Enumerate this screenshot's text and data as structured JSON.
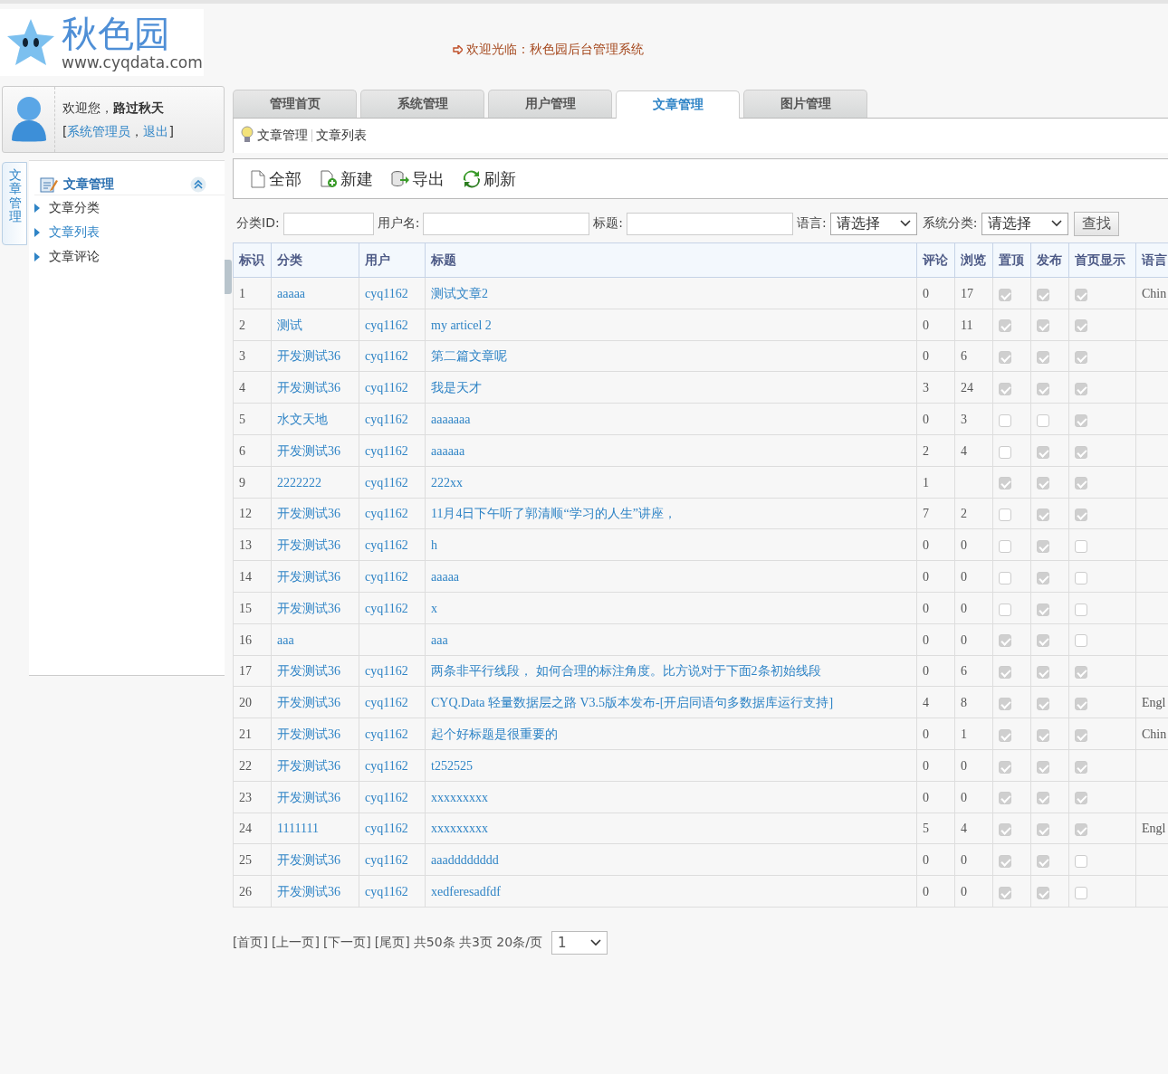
{
  "header": {
    "logo_title": "秋色园",
    "logo_url": "www.cyqdata.com",
    "welcome": "欢迎光临：秋色园后台管理系统"
  },
  "user_panel": {
    "greeting": "欢迎您，",
    "username": "路过秋天",
    "bracket_open": "[",
    "role_link": "系统管理员",
    "separator": "，",
    "logout_link": "退出",
    "bracket_close": "]"
  },
  "sidebar": {
    "vertical_tab": "文章管理",
    "section_title": "文章管理",
    "items": [
      {
        "label": "文章分类",
        "selected": false
      },
      {
        "label": "文章列表",
        "selected": true
      },
      {
        "label": "文章评论",
        "selected": false
      }
    ]
  },
  "tabs": [
    {
      "label": "管理首页",
      "selected": false
    },
    {
      "label": "系统管理",
      "selected": false
    },
    {
      "label": "用户管理",
      "selected": false
    },
    {
      "label": "文章管理",
      "selected": true
    },
    {
      "label": "图片管理",
      "selected": false
    }
  ],
  "breadcrumb": [
    "文章管理",
    "文章列表"
  ],
  "toolbar": [
    {
      "kind": "all",
      "label": "全部"
    },
    {
      "kind": "new",
      "label": "新建"
    },
    {
      "kind": "export",
      "label": "导出"
    },
    {
      "kind": "refresh",
      "label": "刷新"
    }
  ],
  "filters": [
    {
      "kind": "text",
      "label": "分类ID:"
    },
    {
      "kind": "text",
      "label": "用户名:"
    },
    {
      "kind": "text",
      "label": "标题:"
    },
    {
      "kind": "select",
      "label": "语言:",
      "value": "请选择"
    },
    {
      "kind": "select",
      "label": "系统分类:",
      "value": "请选择"
    }
  ],
  "search_button": "查找",
  "table": {
    "columns": [
      "标识",
      "分类",
      "用户",
      "标题",
      "评论",
      "浏览",
      "置顶",
      "发布",
      "首页显示",
      "语言"
    ],
    "rows": [
      {
        "id": "1",
        "category": "aaaaa",
        "user": "cyq1162",
        "title": "测试文章2",
        "comments": "0",
        "views": "17",
        "top": true,
        "published": true,
        "home": true,
        "language": "Chin"
      },
      {
        "id": "2",
        "category": "测试",
        "user": "cyq1162",
        "title": "my articel 2",
        "comments": "0",
        "views": "11",
        "top": true,
        "published": true,
        "home": true
      },
      {
        "id": "3",
        "category": "开发测试36",
        "user": "cyq1162",
        "title": "第二篇文章呢",
        "comments": "0",
        "views": "6",
        "top": true,
        "published": true,
        "home": true
      },
      {
        "id": "4",
        "category": "开发测试36",
        "user": "cyq1162",
        "title": "我是天才",
        "comments": "3",
        "views": "24",
        "top": true,
        "published": true,
        "home": true
      },
      {
        "id": "5",
        "category": "水文天地",
        "user": "cyq1162",
        "title": "aaaaaaa",
        "comments": "0",
        "views": "3",
        "top": false,
        "published": false,
        "home": true
      },
      {
        "id": "6",
        "category": "开发测试36",
        "user": "cyq1162",
        "title": "aaaaaa",
        "comments": "2",
        "views": "4",
        "top": false,
        "published": true,
        "home": true
      },
      {
        "id": "9",
        "category": "2222222",
        "user": "cyq1162",
        "title": "222xx",
        "comments": "1",
        "top": true,
        "published": true,
        "home": true
      },
      {
        "id": "12",
        "category": "开发测试36",
        "user": "cyq1162",
        "title": "11月4日下午听了郭清顺“学习的人生”讲座，",
        "comments": "7",
        "views": "2",
        "top": false,
        "published": true,
        "home": true
      },
      {
        "id": "13",
        "category": "开发测试36",
        "user": "cyq1162",
        "title": "h",
        "comments": "0",
        "views": "0",
        "top": false,
        "published": true,
        "home": false
      },
      {
        "id": "14",
        "category": "开发测试36",
        "user": "cyq1162",
        "title": "aaaaa",
        "comments": "0",
        "views": "0",
        "top": false,
        "published": true,
        "home": false
      },
      {
        "id": "15",
        "category": "开发测试36",
        "user": "cyq1162",
        "title": "x",
        "comments": "0",
        "views": "0",
        "top": false,
        "published": true,
        "home": false
      },
      {
        "id": "16",
        "category": "aaa",
        "title": "aaa",
        "comments": "0",
        "views": "0",
        "top": true,
        "published": true,
        "home": false
      },
      {
        "id": "17",
        "category": "开发测试36",
        "user": "cyq1162",
        "title": "两条非平行线段， 如何合理的标注角度。比方说对于下面2条初始线段",
        "comments": "0",
        "views": "6",
        "top": true,
        "published": true,
        "home": true
      },
      {
        "id": "20",
        "category": "开发测试36",
        "user": "cyq1162",
        "title": "CYQ.Data 轻量数据层之路 V3.5版本发布-[开启同语句多数据库运行支持]",
        "comments": "4",
        "views": "8",
        "top": true,
        "published": true,
        "home": true,
        "language": "Engl"
      },
      {
        "id": "21",
        "category": "开发测试36",
        "user": "cyq1162",
        "title": "起个好标题是很重要的",
        "comments": "0",
        "views": "1",
        "top": true,
        "published": true,
        "home": true,
        "language": "Chin"
      },
      {
        "id": "22",
        "category": "开发测试36",
        "user": "cyq1162",
        "title": "t252525",
        "comments": "0",
        "views": "0",
        "top": true,
        "published": true,
        "home": true
      },
      {
        "id": "23",
        "category": "开发测试36",
        "user": "cyq1162",
        "title": "xxxxxxxxx",
        "comments": "0",
        "views": "0",
        "top": true,
        "published": true,
        "home": true
      },
      {
        "id": "24",
        "category": "1111111",
        "user": "cyq1162",
        "title": "xxxxxxxxx",
        "comments": "5",
        "views": "4",
        "top": true,
        "published": true,
        "home": true,
        "language": "Engl"
      },
      {
        "id": "25",
        "category": "开发测试36",
        "user": "cyq1162",
        "title": "aaadddddddd",
        "comments": "0",
        "views": "0",
        "top": true,
        "published": true,
        "home": false
      },
      {
        "id": "26",
        "category": "开发测试36",
        "user": "cyq1162",
        "title": "xedferesadfdf",
        "comments": "0",
        "views": "0",
        "top": true,
        "published": true,
        "home": false
      }
    ]
  },
  "pagination": {
    "links": [
      "[首页]",
      "[上一页]",
      "[下一页]",
      "[尾页]"
    ],
    "summary": "共50条 共3页 20条/页",
    "page": "1"
  }
}
